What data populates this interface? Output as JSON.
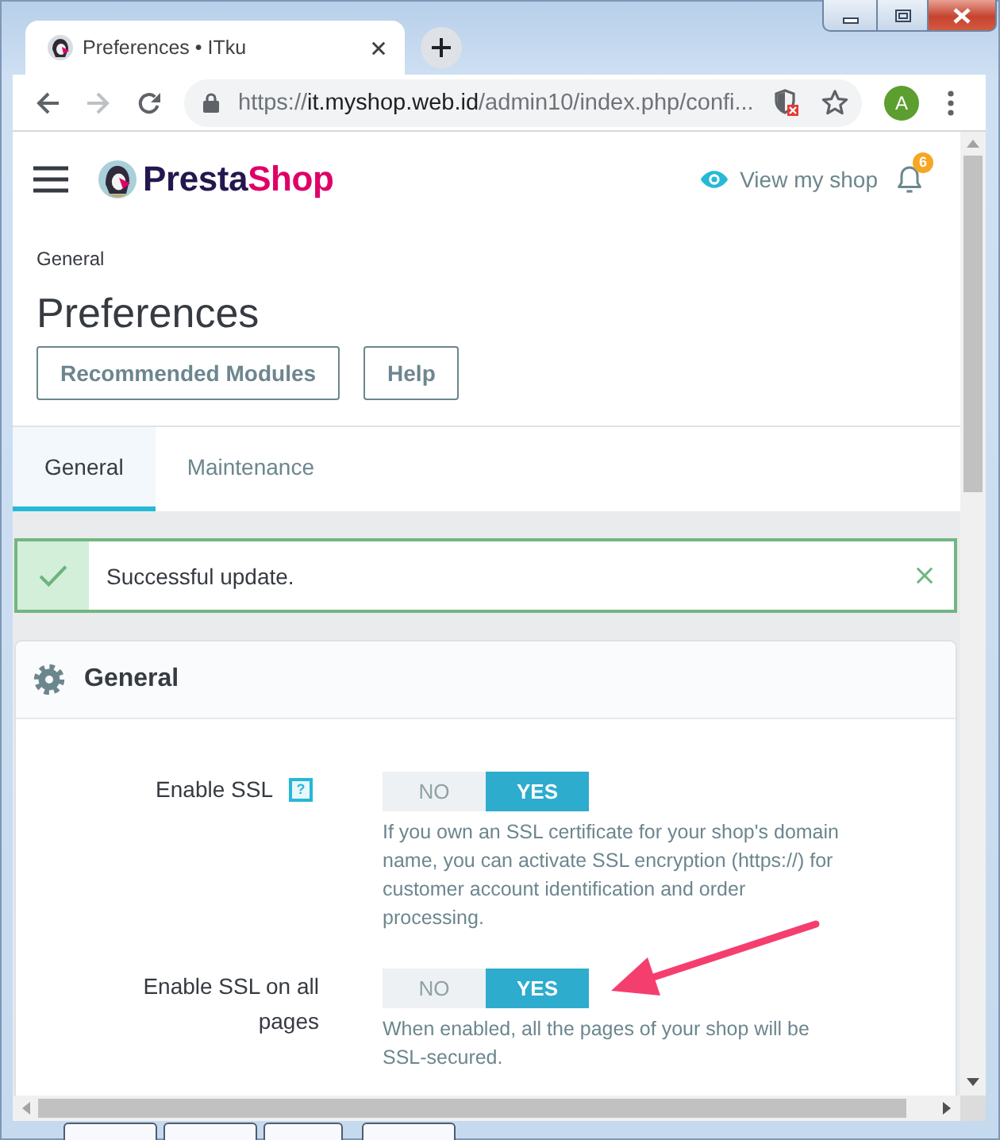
{
  "browser": {
    "tab": {
      "title": "Preferences • ITku"
    },
    "navigation": {
      "back_disabled": false,
      "forward_disabled": true
    },
    "address_bar": {
      "scheme": "https://",
      "host": "it.myshop.web.id",
      "path": "/admin10/index.php/confi..."
    },
    "profile": {
      "initial": "A"
    }
  },
  "header": {
    "brand": {
      "part_1": "Presta",
      "part_2": "Shop"
    },
    "view_shop": "View my shop",
    "notifications": "6"
  },
  "breadcrumb": "General",
  "page_title": "Preferences",
  "toolbar_buttons": [
    {
      "label": "Recommended Modules"
    },
    {
      "label": "Help"
    }
  ],
  "tabs": [
    {
      "label": "General",
      "selected": true
    },
    {
      "label": "Maintenance",
      "selected": false
    }
  ],
  "alert": {
    "kind": "success",
    "message": "Successful update."
  },
  "panel": {
    "title": "General",
    "fields": [
      {
        "label": "Enable SSL",
        "help_mark": "?",
        "options": [
          {
            "label": "NO",
            "selected": false
          },
          {
            "label": "YES",
            "selected": true
          }
        ],
        "hint": "If you own an SSL certificate for your shop's domain name, you can activate SSL encryption (https://) for customer account identification and order processing.",
        "pointed_at": false
      },
      {
        "label": "Enable SSL on all pages",
        "options": [
          {
            "label": "NO",
            "selected": false
          },
          {
            "label": "YES",
            "selected": true
          }
        ],
        "hint": "When enabled, all the pages of your shop will be SSL-secured.",
        "pointed_at": true
      }
    ]
  }
}
